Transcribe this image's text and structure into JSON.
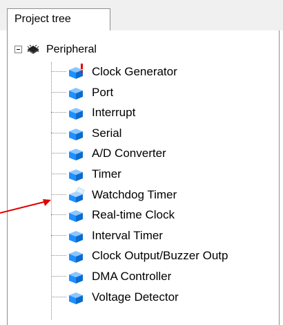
{
  "tab": {
    "label": "Project tree"
  },
  "tree": {
    "root": {
      "label": "Peripheral",
      "icon": "chip-icon"
    },
    "items": [
      {
        "label": "Clock Generator",
        "icon": "cube-warning-icon"
      },
      {
        "label": "Port",
        "icon": "cube-icon"
      },
      {
        "label": "Interrupt",
        "icon": "cube-icon"
      },
      {
        "label": "Serial",
        "icon": "cube-icon"
      },
      {
        "label": "A/D Converter",
        "icon": "cube-icon"
      },
      {
        "label": "Timer",
        "icon": "cube-icon"
      },
      {
        "label": "Watchdog Timer",
        "icon": "cube-open-icon"
      },
      {
        "label": "Real-time Clock",
        "icon": "cube-icon"
      },
      {
        "label": "Interval Timer",
        "icon": "cube-icon"
      },
      {
        "label": "Clock Output/Buzzer Outp",
        "icon": "cube-icon"
      },
      {
        "label": "DMA Controller",
        "icon": "cube-icon"
      },
      {
        "label": "Voltage Detector",
        "icon": "cube-icon"
      }
    ]
  },
  "colors": {
    "accent_blue": "#1e90ff",
    "arrow_red": "#e00000",
    "warning_red": "#e00000"
  }
}
